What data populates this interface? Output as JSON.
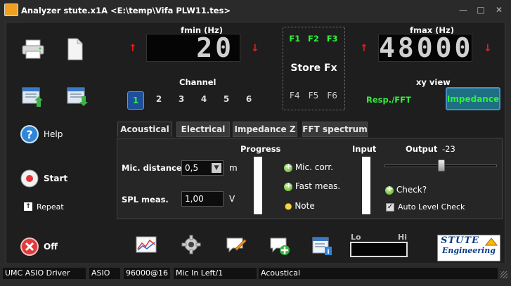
{
  "window": {
    "title": "Analyzer stute.x1A <E:\\temp\\Vifa PLW11.tes>",
    "minimize_glyph": "—",
    "maximize_glyph": "□",
    "close_glyph": "✕"
  },
  "fmin": {
    "label": "fmin (Hz)",
    "value": "20"
  },
  "fmax": {
    "label": "fmax (Hz)",
    "value": "48000"
  },
  "store": {
    "label": "Store Fx",
    "top_slots": [
      "F1",
      "F2",
      "F3"
    ],
    "bottom_slots": [
      "F4",
      "F5",
      "F6"
    ]
  },
  "channel": {
    "label": "Channel",
    "options": [
      "1",
      "2",
      "3",
      "4",
      "5",
      "6"
    ],
    "selected": "1"
  },
  "xyview": {
    "label": "xy view",
    "resp_label": "Resp./FFT",
    "impedance_label": "Impedance"
  },
  "sidebar": {
    "help_label": "Help",
    "start_label": "Start",
    "repeat_label": "Repeat",
    "off_label": "Off"
  },
  "tabs": [
    "Acoustical",
    "Electrical",
    "Impedance Z",
    "FFT spectrum"
  ],
  "active_tab": "Acoustical",
  "acoustical": {
    "mic_distance_label": "Mic. distance",
    "mic_distance_value": "0,5",
    "mic_distance_unit": "m",
    "spl_label": "SPL meas.",
    "spl_value": "1,00",
    "spl_unit": "V",
    "progress_label": "Progress",
    "mic_corr_label": "Mic. corr.",
    "fast_meas_label": "Fast meas.",
    "note_label": "Note",
    "input_label": "Input",
    "output_label": "Output",
    "output_value": "-23",
    "check_label": "Check?",
    "auto_level_label": "Auto Level Check",
    "auto_level_checked": true
  },
  "level": {
    "lo_label": "Lo",
    "hi_label": "Hi"
  },
  "logo": {
    "line1": "STUTE",
    "line2": "Engineering"
  },
  "status": {
    "driver": "UMC ASIO Driver",
    "type": "ASIO",
    "rate": "96000@16",
    "input": "Mic In Left/1",
    "mode": "Acoustical"
  },
  "colors": {
    "accent_green": "#2ef23c",
    "arrow_red": "#e02020",
    "active_blue": "#1e4f9a",
    "impedance_button": "#1d6f82"
  }
}
